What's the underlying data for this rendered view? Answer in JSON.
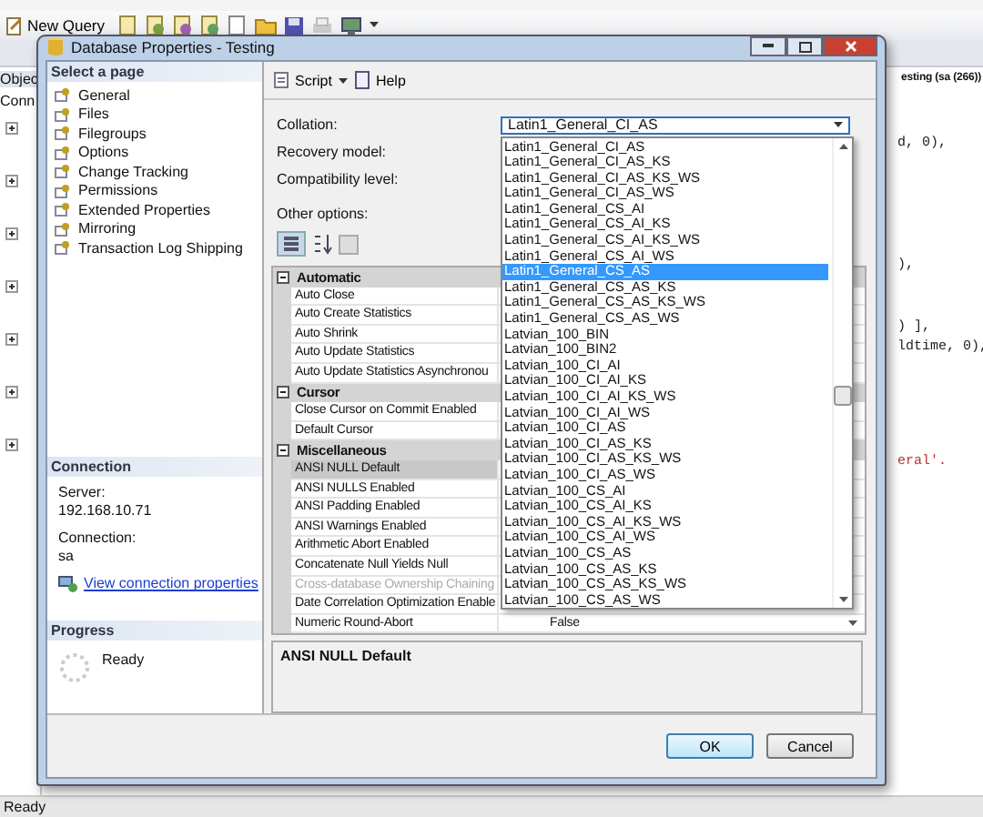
{
  "app": {
    "toolbar": {
      "new_query": "New Query"
    },
    "object_explorer": {
      "title": "Objec",
      "connect": "Conn"
    },
    "editor": {
      "tab_title": "esting (sa (266))",
      "code_lines": [
        {
          "text": "d, 0),",
          "kind": "code"
        },
        {
          "text": "),",
          "kind": "code"
        },
        {
          "text": ") ],",
          "kind": "code"
        },
        {
          "text": "ldtime, 0),",
          "kind": "code"
        },
        {
          "text": "eral'.",
          "kind": "string"
        }
      ]
    },
    "status_bar": "Ready"
  },
  "dialog": {
    "title": "Database Properties - Testing",
    "select_page": {
      "header": "Select a page",
      "items": [
        "General",
        "Files",
        "Filegroups",
        "Options",
        "Change Tracking",
        "Permissions",
        "Extended Properties",
        "Mirroring",
        "Transaction Log Shipping"
      ]
    },
    "connection": {
      "header": "Connection",
      "server_label": "Server:",
      "server": "192.168.10.71",
      "connection_label": "Connection:",
      "connection": "sa",
      "link": "View connection properties"
    },
    "progress": {
      "header": "Progress",
      "status": "Ready"
    },
    "toolbar": {
      "script": "Script",
      "help": "Help"
    },
    "collation": {
      "label": "Collation:",
      "value": "Latin1_General_CI_AS"
    },
    "recovery_model": {
      "label": "Recovery model:"
    },
    "compatibility_level": {
      "label": "Compatibility level:"
    },
    "other_options": "Other options:",
    "property_grid": [
      {
        "category": "Automatic",
        "rows": [
          {
            "name": "Auto Close",
            "selected": false,
            "disabled": false
          },
          {
            "name": "Auto Create Statistics",
            "selected": false,
            "disabled": false
          },
          {
            "name": "Auto Shrink",
            "selected": false,
            "disabled": false
          },
          {
            "name": "Auto Update Statistics",
            "selected": false,
            "disabled": false
          },
          {
            "name": "Auto Update Statistics Asynchronou",
            "selected": false,
            "disabled": false
          }
        ]
      },
      {
        "category": "Cursor",
        "rows": [
          {
            "name": "Close Cursor on Commit Enabled",
            "selected": false,
            "disabled": false
          },
          {
            "name": "Default Cursor",
            "selected": false,
            "disabled": false
          }
        ]
      },
      {
        "category": "Miscellaneous",
        "rows": [
          {
            "name": "ANSI NULL Default",
            "selected": true,
            "disabled": false
          },
          {
            "name": "ANSI NULLS Enabled",
            "selected": false,
            "disabled": false
          },
          {
            "name": "ANSI Padding Enabled",
            "selected": false,
            "disabled": false
          },
          {
            "name": "ANSI Warnings Enabled",
            "selected": false,
            "disabled": false
          },
          {
            "name": "Arithmetic Abort Enabled",
            "selected": false,
            "disabled": false
          },
          {
            "name": "Concatenate Null Yields Null",
            "selected": false,
            "disabled": false
          },
          {
            "name": "Cross-database Ownership Chaining",
            "selected": false,
            "disabled": true
          },
          {
            "name": "Date Correlation Optimization Enable",
            "selected": false,
            "disabled": false
          },
          {
            "name": "Numeric Round-Abort",
            "value": "False",
            "selected": false,
            "disabled": false
          }
        ]
      }
    ],
    "description": "ANSI NULL Default",
    "collation_options": [
      {
        "label": "Latin1_General_CI_AS",
        "selected": false
      },
      {
        "label": "Latin1_General_CI_AS_KS",
        "selected": false
      },
      {
        "label": "Latin1_General_CI_AS_KS_WS",
        "selected": false
      },
      {
        "label": "Latin1_General_CI_AS_WS",
        "selected": false
      },
      {
        "label": "Latin1_General_CS_AI",
        "selected": false
      },
      {
        "label": "Latin1_General_CS_AI_KS",
        "selected": false
      },
      {
        "label": "Latin1_General_CS_AI_KS_WS",
        "selected": false
      },
      {
        "label": "Latin1_General_CS_AI_WS",
        "selected": false
      },
      {
        "label": "Latin1_General_CS_AS",
        "selected": true
      },
      {
        "label": "Latin1_General_CS_AS_KS",
        "selected": false
      },
      {
        "label": "Latin1_General_CS_AS_KS_WS",
        "selected": false
      },
      {
        "label": "Latin1_General_CS_AS_WS",
        "selected": false
      },
      {
        "label": "Latvian_100_BIN",
        "selected": false
      },
      {
        "label": "Latvian_100_BIN2",
        "selected": false
      },
      {
        "label": "Latvian_100_CI_AI",
        "selected": false
      },
      {
        "label": "Latvian_100_CI_AI_KS",
        "selected": false
      },
      {
        "label": "Latvian_100_CI_AI_KS_WS",
        "selected": false
      },
      {
        "label": "Latvian_100_CI_AI_WS",
        "selected": false
      },
      {
        "label": "Latvian_100_CI_AS",
        "selected": false
      },
      {
        "label": "Latvian_100_CI_AS_KS",
        "selected": false
      },
      {
        "label": "Latvian_100_CI_AS_KS_WS",
        "selected": false
      },
      {
        "label": "Latvian_100_CI_AS_WS",
        "selected": false
      },
      {
        "label": "Latvian_100_CS_AI",
        "selected": false
      },
      {
        "label": "Latvian_100_CS_AI_KS",
        "selected": false
      },
      {
        "label": "Latvian_100_CS_AI_KS_WS",
        "selected": false
      },
      {
        "label": "Latvian_100_CS_AI_WS",
        "selected": false
      },
      {
        "label": "Latvian_100_CS_AS",
        "selected": false
      },
      {
        "label": "Latvian_100_CS_AS_KS",
        "selected": false
      },
      {
        "label": "Latvian_100_CS_AS_KS_WS",
        "selected": false
      },
      {
        "label": "Latvian_100_CS_AS_WS",
        "selected": false
      }
    ],
    "buttons": [
      {
        "label": "OK",
        "kind": "default"
      },
      {
        "label": "Cancel",
        "kind": "normal"
      }
    ]
  }
}
